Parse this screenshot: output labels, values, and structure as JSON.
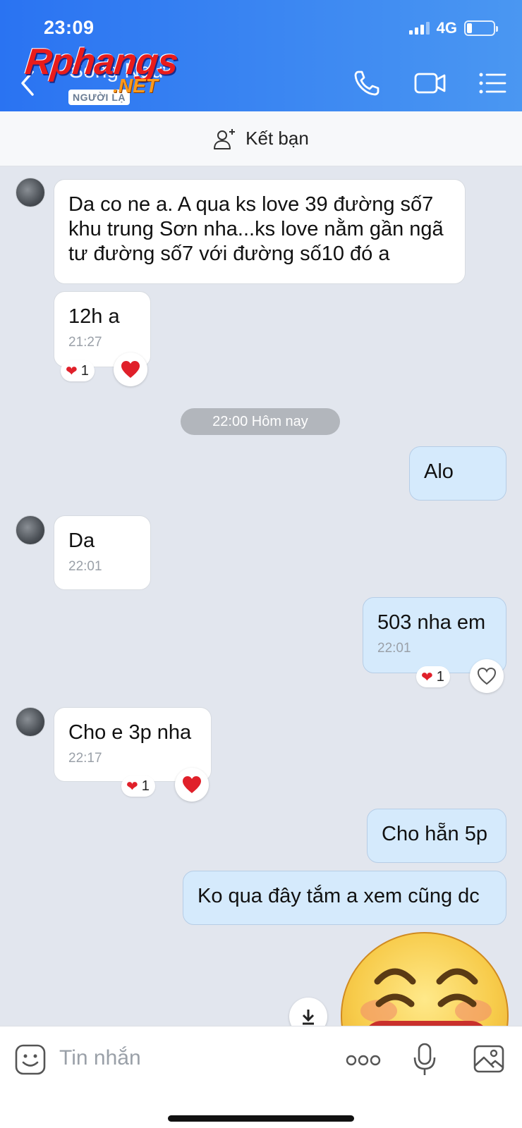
{
  "status_bar": {
    "time": "23:09",
    "network": "4G",
    "battery_level": 0.2
  },
  "header": {
    "contact_name": "Song Ngư",
    "badge": "NGƯỜI LẠ",
    "watermark_text": "Rphangs",
    "watermark_sub": ".NET",
    "icons": [
      "back-arrow-icon",
      "phone-icon",
      "video-call-icon",
      "menu-icon"
    ]
  },
  "add_friend": {
    "label": "Kết bạn",
    "icon": "add-user-icon"
  },
  "conversation": {
    "date_separator": "22:00 Hôm nay",
    "messages": [
      {
        "direction": "in",
        "text": "Da co ne a. A qua ks love 39 đường số7 khu trung Sơn nha...ks love nằm gần ngã tư đường số7 với đường số10 đó a"
      },
      {
        "direction": "in",
        "text": "12h a",
        "time": "21:27",
        "reaction": "❤",
        "reaction_count": "1"
      },
      {
        "direction": "out",
        "text": "Alo"
      },
      {
        "direction": "in",
        "text": "Da",
        "time": "22:01"
      },
      {
        "direction": "out",
        "text": "503 nha em",
        "time": "22:01",
        "reaction": "❤",
        "reaction_count": "1"
      },
      {
        "direction": "in",
        "text": "Cho e 3p nha",
        "time": "22:17",
        "reaction": "❤",
        "reaction_count": "1"
      },
      {
        "direction": "out",
        "text": "Cho hẵn 5p"
      },
      {
        "direction": "out",
        "text": "Ko qua đây tắm a xem cũng dc"
      }
    ],
    "sticker": "smiling-face-emoji"
  },
  "input_bar": {
    "placeholder": "Tin nhắn",
    "icons": [
      "sticker-icon",
      "more-icon",
      "microphone-icon",
      "image-icon"
    ]
  }
}
